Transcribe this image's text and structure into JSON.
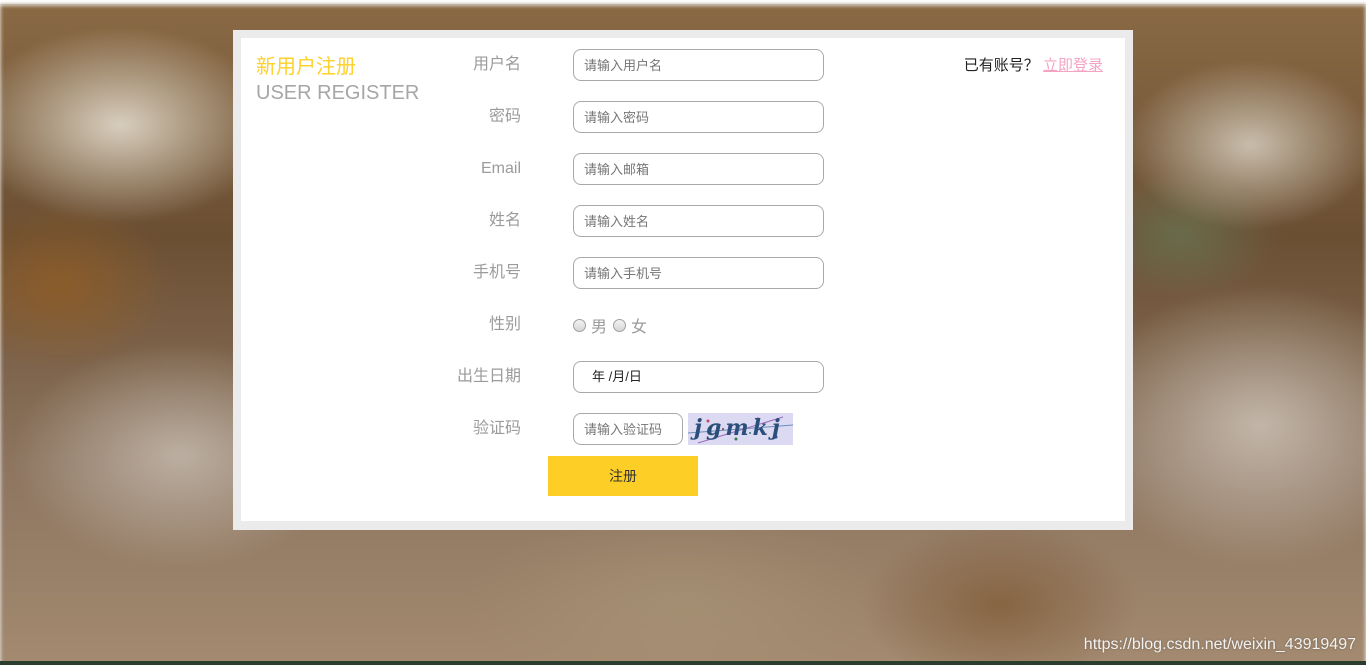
{
  "header": {
    "title_cn": "新用户注册",
    "title_en": "USER REGISTER"
  },
  "login_prompt": {
    "question": "已有账号？",
    "link_label": "立即登录"
  },
  "form": {
    "username": {
      "label": "用户名",
      "placeholder": "请输入用户名"
    },
    "password": {
      "label": "密码",
      "placeholder": "请输入密码"
    },
    "email": {
      "label": "Email",
      "placeholder": "请输入邮箱"
    },
    "name": {
      "label": "姓名",
      "placeholder": "请输入姓名"
    },
    "phone": {
      "label": "手机号",
      "placeholder": "请输入手机号"
    },
    "gender": {
      "label": "性别",
      "options": [
        "男",
        "女"
      ]
    },
    "birthday": {
      "label": "出生日期",
      "value": "年 /月/日"
    },
    "captcha": {
      "label": "验证码",
      "placeholder": "请输入验证码",
      "image_text": "jgmkj"
    },
    "submit_label": "注册"
  },
  "watermark": "https://blog.csdn.net/weixin_43919497",
  "colors": {
    "accent_yellow": "#fdcf26",
    "title_grey": "#a6a6a6",
    "link_pink": "#f5a3c2",
    "label_grey": "#9b9b9b"
  }
}
